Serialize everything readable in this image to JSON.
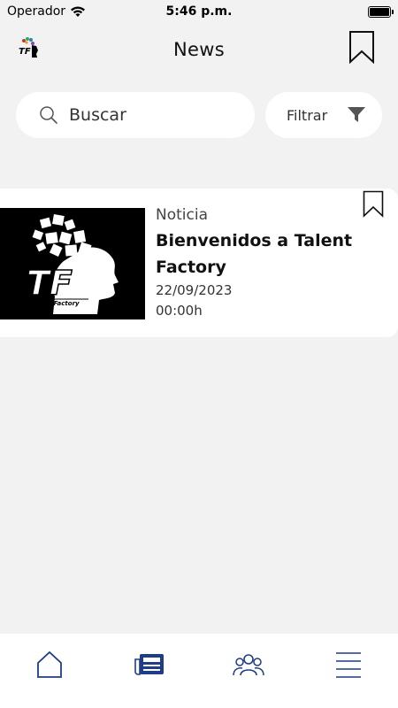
{
  "status_bar": {
    "carrier": "Operador",
    "time": "5:46 p.m."
  },
  "header": {
    "logo_text": "TF",
    "title": "News"
  },
  "search": {
    "placeholder": "Buscar"
  },
  "filter": {
    "label": "Filtrar"
  },
  "news": [
    {
      "category": "Noticia",
      "title": "Bienvenidos a Talent Factory",
      "date": "22/09/2023",
      "time": "00:00h",
      "image_text": "TF",
      "image_subtext": "Talent Factory"
    }
  ],
  "nav": {
    "items": [
      "home-icon",
      "newspaper-icon",
      "people-icon",
      "menu-icon"
    ],
    "active": "newspaper-icon",
    "accent_color": "#1f3c88"
  }
}
